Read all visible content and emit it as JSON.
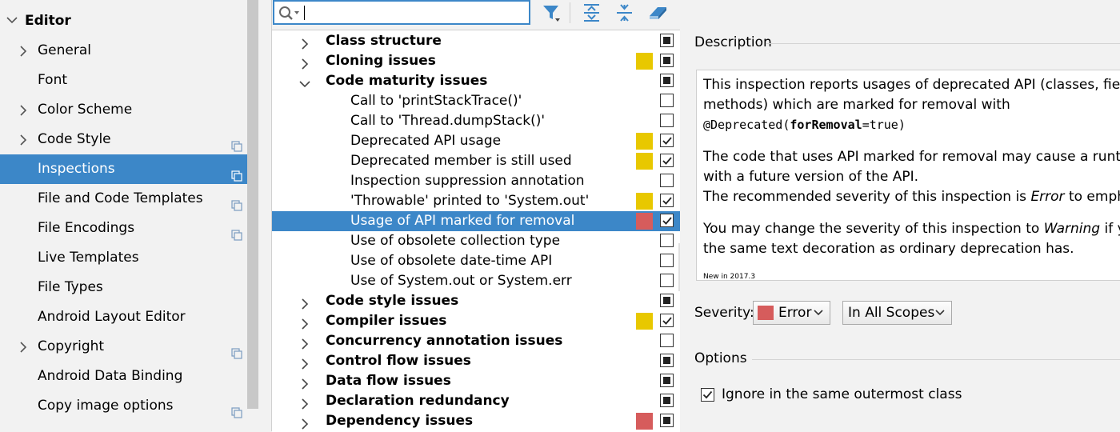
{
  "sidebar": {
    "items": [
      {
        "label": "Editor",
        "arrow": "down",
        "bold": true
      },
      {
        "label": "General",
        "arrow": "right"
      },
      {
        "label": "Font"
      },
      {
        "label": "Color Scheme",
        "arrow": "right"
      },
      {
        "label": "Code Style",
        "arrow": "right",
        "copy": true
      },
      {
        "label": "Inspections",
        "copy": true,
        "selected": true
      },
      {
        "label": "File and Code Templates",
        "copy": true
      },
      {
        "label": "File Encodings",
        "copy": true
      },
      {
        "label": "Live Templates"
      },
      {
        "label": "File Types"
      },
      {
        "label": "Android Layout Editor"
      },
      {
        "label": "Copyright",
        "arrow": "right",
        "copy": true
      },
      {
        "label": "Android Data Binding"
      },
      {
        "label": "Copy image options",
        "copy": true
      }
    ]
  },
  "search": {
    "value": "",
    "placeholder": ""
  },
  "colors": {
    "accent": "#3c87c8",
    "warning": "#e8c800",
    "error": "#d65c5c"
  },
  "tree": {
    "rows": [
      {
        "label": "Class structure",
        "type": "group",
        "expanded": false,
        "sev": "",
        "check": "partial"
      },
      {
        "label": "Cloning issues",
        "type": "group",
        "expanded": false,
        "sev": "warning",
        "check": "partial"
      },
      {
        "label": "Code maturity issues",
        "type": "group",
        "expanded": true,
        "sev": "",
        "check": "partial"
      },
      {
        "label": "Call to 'printStackTrace()'",
        "type": "child",
        "sev": "",
        "check": "none"
      },
      {
        "label": "Call to 'Thread.dumpStack()'",
        "type": "child",
        "sev": "",
        "check": "none"
      },
      {
        "label": "Deprecated API usage",
        "type": "child",
        "sev": "warning",
        "check": "checked"
      },
      {
        "label": "Deprecated member is still used",
        "type": "child",
        "sev": "warning",
        "check": "checked"
      },
      {
        "label": "Inspection suppression annotation",
        "type": "child",
        "sev": "",
        "check": "none"
      },
      {
        "label": "'Throwable' printed to 'System.out'",
        "type": "child",
        "sev": "warning",
        "check": "checked"
      },
      {
        "label": "Usage of API marked for removal",
        "type": "child",
        "sev": "error",
        "check": "checked",
        "selected": true
      },
      {
        "label": "Use of obsolete collection type",
        "type": "child",
        "sev": "",
        "check": "none"
      },
      {
        "label": "Use of obsolete date-time API",
        "type": "child",
        "sev": "",
        "check": "none"
      },
      {
        "label": "Use of System.out or System.err",
        "type": "child",
        "sev": "",
        "check": "none"
      },
      {
        "label": "Code style issues",
        "type": "group",
        "expanded": false,
        "sev": "",
        "check": "partial"
      },
      {
        "label": "Compiler issues",
        "type": "group",
        "expanded": false,
        "sev": "warning",
        "check": "checked"
      },
      {
        "label": "Concurrency annotation issues",
        "type": "group",
        "expanded": false,
        "sev": "",
        "check": "none"
      },
      {
        "label": "Control flow issues",
        "type": "group",
        "expanded": false,
        "sev": "",
        "check": "partial"
      },
      {
        "label": "Data flow issues",
        "type": "group",
        "expanded": false,
        "sev": "",
        "check": "partial"
      },
      {
        "label": "Declaration redundancy",
        "type": "group",
        "expanded": false,
        "sev": "",
        "check": "partial"
      },
      {
        "label": "Dependency issues",
        "type": "group",
        "expanded": false,
        "sev": "error",
        "check": "partial"
      }
    ]
  },
  "description": {
    "title": "Description",
    "line1": "This inspection reports usages of deprecated API (classes, fields, and",
    "line2": "methods) which are marked for removal with",
    "code_prefix": "@Deprecated(",
    "code_bold": "forRemoval",
    "code_suffix": "=true)",
    "line4": "The code that uses API marked for removal may cause a runtime error",
    "line5": "with a future version of the API.",
    "line6_a": "The recommended severity of this inspection is ",
    "line6_em": "Error",
    "line6_b": " to emphasize",
    "line7_a": "You may change the severity of this inspection to ",
    "line7_em": "Warning",
    "line7_b": " if you want",
    "line8": "the same text decoration as ordinary deprecation has.",
    "new_in": "New in 2017.3"
  },
  "severity": {
    "label": "Severity:",
    "value": "Error",
    "scope": "In All Scopes"
  },
  "options": {
    "title": "Options",
    "ignore_label": "Ignore in the same outermost class",
    "ignore_checked": true
  }
}
